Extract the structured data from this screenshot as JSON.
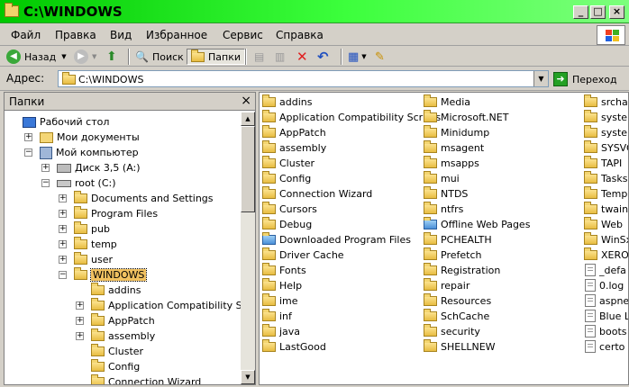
{
  "window": {
    "title": "C:\\WINDOWS",
    "buttons": [
      "_",
      "□",
      "×"
    ]
  },
  "menu": [
    "Файл",
    "Правка",
    "Вид",
    "Избранное",
    "Сервис",
    "Справка"
  ],
  "toolbar": {
    "back_label": "Назад",
    "search_label": "Поиск",
    "folders_label": "Папки"
  },
  "address": {
    "label": "Адрес:",
    "value": "C:\\WINDOWS",
    "go_label": "Переход"
  },
  "folders_pane": {
    "title": "Папки",
    "close": "×"
  },
  "tree": [
    {
      "label": "Рабочий стол",
      "icon": "desktop-icon",
      "exp": ""
    },
    {
      "label": "Мои документы",
      "icon": "my-documents-icon",
      "exp": "+"
    },
    {
      "label": "Мой компьютер",
      "icon": "my-computer-icon",
      "exp": "−"
    },
    {
      "label": "Диск 3,5 (A:)",
      "icon": "floppy-icon",
      "exp": "+"
    },
    {
      "label": "root (C:)",
      "icon": "drive-icon",
      "exp": "−"
    },
    {
      "label": "Documents and Settings",
      "icon": "folder-icon",
      "exp": "+"
    },
    {
      "label": "Program Files",
      "icon": "folder-icon",
      "exp": "+"
    },
    {
      "label": "pub",
      "icon": "folder-icon",
      "exp": "+"
    },
    {
      "label": "temp",
      "icon": "folder-icon",
      "exp": "+"
    },
    {
      "label": "user",
      "icon": "folder-icon",
      "exp": "+"
    },
    {
      "label": "WINDOWS",
      "icon": "open-folder-icon",
      "exp": "−",
      "selected": true
    },
    {
      "label": "addins",
      "icon": "folder-icon",
      "exp": ""
    },
    {
      "label": "Application Compatibility Scripts",
      "icon": "folder-icon",
      "exp": "+"
    },
    {
      "label": "AppPatch",
      "icon": "folder-icon",
      "exp": "+"
    },
    {
      "label": "assembly",
      "icon": "folder-icon",
      "exp": "+"
    },
    {
      "label": "Cluster",
      "icon": "folder-icon",
      "exp": ""
    },
    {
      "label": "Config",
      "icon": "folder-icon",
      "exp": ""
    },
    {
      "label": "Connection Wizard",
      "icon": "folder-icon",
      "exp": ""
    }
  ],
  "files": {
    "col1": [
      {
        "label": "addins",
        "icon": "folder-icon"
      },
      {
        "label": "Application Compatibility Scripts",
        "icon": "folder-icon"
      },
      {
        "label": "AppPatch",
        "icon": "folder-icon"
      },
      {
        "label": "assembly",
        "icon": "folder-icon"
      },
      {
        "label": "Cluster",
        "icon": "folder-icon"
      },
      {
        "label": "Config",
        "icon": "folder-icon"
      },
      {
        "label": "Connection Wizard",
        "icon": "folder-icon"
      },
      {
        "label": "Cursors",
        "icon": "folder-icon"
      },
      {
        "label": "Debug",
        "icon": "folder-icon"
      },
      {
        "label": "Downloaded Program Files",
        "icon": "special-folder-icon"
      },
      {
        "label": "Driver Cache",
        "icon": "folder-icon"
      },
      {
        "label": "Fonts",
        "icon": "folder-icon"
      },
      {
        "label": "Help",
        "icon": "folder-icon"
      },
      {
        "label": "ime",
        "icon": "folder-icon"
      },
      {
        "label": "inf",
        "icon": "folder-icon"
      },
      {
        "label": "java",
        "icon": "folder-icon"
      },
      {
        "label": "LastGood",
        "icon": "folder-icon"
      }
    ],
    "col2": [
      {
        "label": "Media",
        "icon": "folder-icon"
      },
      {
        "label": "Microsoft.NET",
        "icon": "folder-icon"
      },
      {
        "label": "Minidump",
        "icon": "folder-icon"
      },
      {
        "label": "msagent",
        "icon": "folder-icon"
      },
      {
        "label": "msapps",
        "icon": "folder-icon"
      },
      {
        "label": "mui",
        "icon": "folder-icon"
      },
      {
        "label": "NTDS",
        "icon": "folder-icon"
      },
      {
        "label": "ntfrs",
        "icon": "folder-icon"
      },
      {
        "label": "Offline Web Pages",
        "icon": "special-folder-icon"
      },
      {
        "label": "PCHEALTH",
        "icon": "folder-icon"
      },
      {
        "label": "Prefetch",
        "icon": "folder-icon"
      },
      {
        "label": "Registration",
        "icon": "folder-icon"
      },
      {
        "label": "repair",
        "icon": "folder-icon"
      },
      {
        "label": "Resources",
        "icon": "folder-icon"
      },
      {
        "label": "SchCache",
        "icon": "folder-icon"
      },
      {
        "label": "security",
        "icon": "folder-icon"
      },
      {
        "label": "SHELLNEW",
        "icon": "folder-icon"
      }
    ],
    "col3": [
      {
        "label": "srcha",
        "icon": "folder-icon"
      },
      {
        "label": "syste",
        "icon": "folder-icon"
      },
      {
        "label": "syste",
        "icon": "folder-icon"
      },
      {
        "label": "SYSVO",
        "icon": "folder-icon"
      },
      {
        "label": "TAPI",
        "icon": "folder-icon"
      },
      {
        "label": "Tasks",
        "icon": "folder-icon"
      },
      {
        "label": "Temp",
        "icon": "folder-icon"
      },
      {
        "label": "twain",
        "icon": "folder-icon"
      },
      {
        "label": "Web",
        "icon": "folder-icon"
      },
      {
        "label": "WinSx",
        "icon": "folder-icon"
      },
      {
        "label": "XERO",
        "icon": "folder-icon"
      },
      {
        "label": "_defa",
        "icon": "file-icon"
      },
      {
        "label": "0.log",
        "icon": "file-icon"
      },
      {
        "label": "aspne",
        "icon": "file-icon"
      },
      {
        "label": "Blue L",
        "icon": "file-icon"
      },
      {
        "label": "boots",
        "icon": "file-icon"
      },
      {
        "label": "certo",
        "icon": "file-icon"
      }
    ]
  }
}
